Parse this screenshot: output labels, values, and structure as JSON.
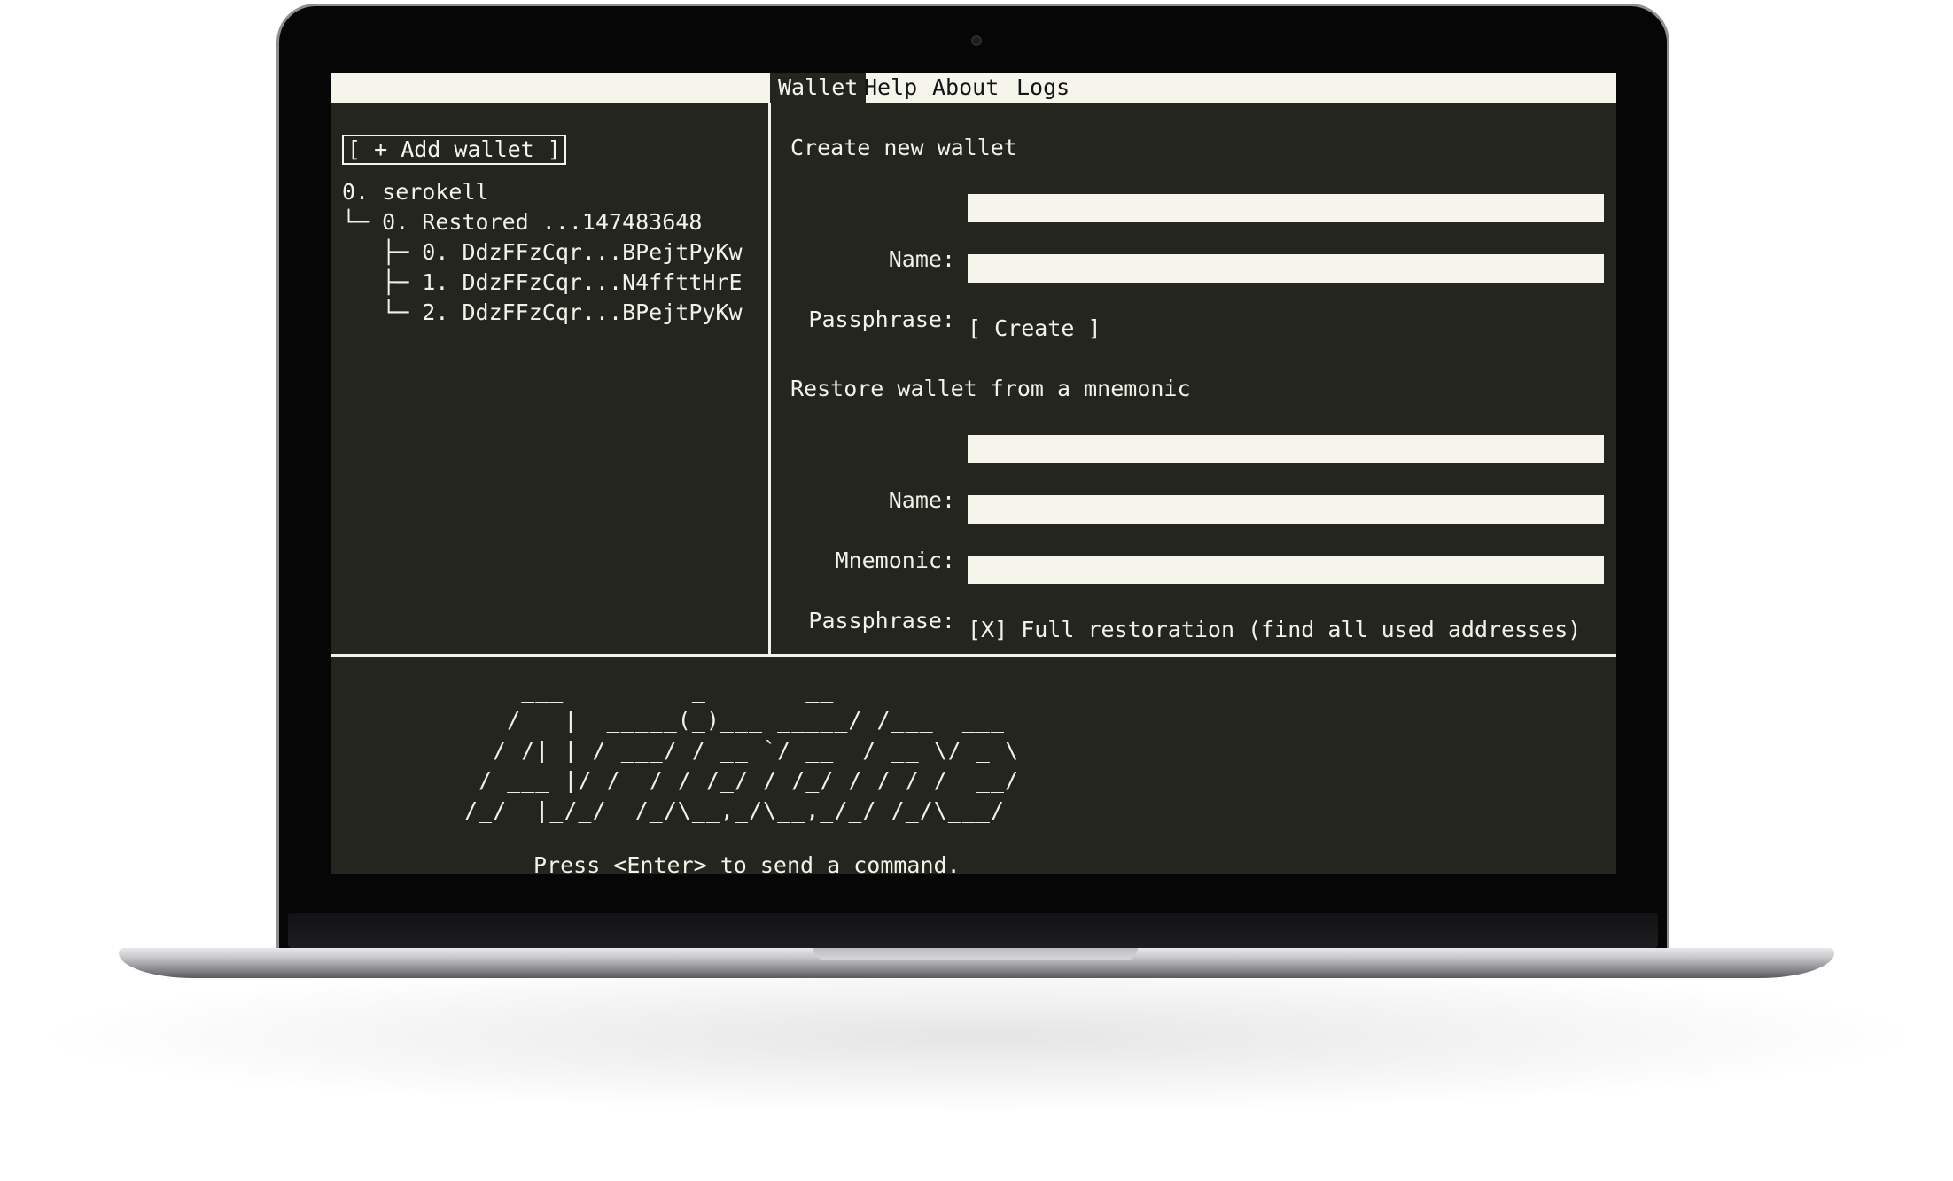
{
  "menubar": {
    "tabs": [
      {
        "label": "Wallet",
        "active": true
      },
      {
        "label": "Help",
        "active": false
      },
      {
        "label": "About",
        "active": false
      },
      {
        "label": "Logs",
        "active": false
      }
    ]
  },
  "sidebar": {
    "add_wallet_label": "[ + Add wallet ]",
    "tree": [
      "0. serokell",
      "└─ 0. Restored ...147483648",
      "   ├─ 0. DdzFFzCqr...BPejtPyKw",
      "   ├─ 1. DdzFFzCqr...N4ffttHrE",
      "   └─ 2. DdzFFzCqr...BPejtPyKw"
    ]
  },
  "create": {
    "heading": "Create new wallet",
    "name_label": "Name:",
    "name_value": "",
    "passphrase_label": "Passphrase:",
    "passphrase_value": "",
    "create_button": "[ Create ]"
  },
  "restore": {
    "heading": "Restore wallet from a mnemonic",
    "name_label": "Name:",
    "name_value": "",
    "mnemonic_label": "Mnemonic:",
    "mnemonic_value": "",
    "passphrase_label": "Passphrase:",
    "passphrase_value": "",
    "full_restoration_label": "[X] Full restoration (find all used addresses)"
  },
  "console": {
    "logo_ascii": "    ___         _       __\n   /   |  _____(_)___ _____/ /___  ___\n  / /| | / ___/ / __ `/ __  / __ \\/ _ \\\n / ___ |/ /  / / /_/ / /_/ / / / /  __/\n/_/  |_/_/  /_/\\__,_/\\__,_/_/ /_/\\___/",
    "hint": "Press <Enter> to send a command."
  },
  "colors": {
    "terminal_bg": "#252520",
    "terminal_fg": "#f2f2e8",
    "field_bg": "#f5f5ec"
  }
}
